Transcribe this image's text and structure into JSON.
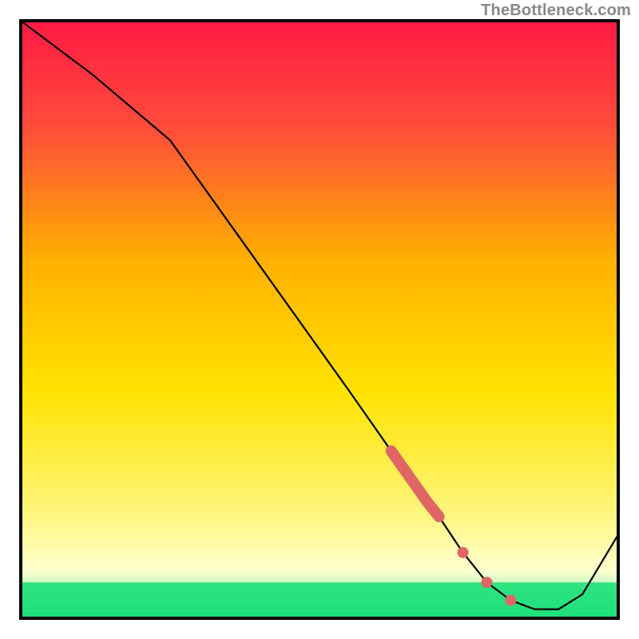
{
  "watermark": "TheBottleneck.com",
  "chart_data": {
    "type": "line",
    "title": "",
    "xlabel": "",
    "ylabel": "",
    "xlim": [
      0,
      100
    ],
    "ylim": [
      0,
      100
    ],
    "series": [
      {
        "name": "curve",
        "x": [
          0,
          12,
          25,
          35,
          45,
          55,
          62,
          68,
          70,
          74,
          78,
          82,
          86,
          90,
          94,
          100
        ],
        "y": [
          100,
          91,
          80,
          66,
          52,
          38,
          28,
          19.5,
          17,
          11,
          6,
          3,
          1.5,
          1.5,
          4,
          14
        ]
      }
    ],
    "highlight_segment": {
      "comment": "thick salmon overlay on the descending portion",
      "x": [
        62,
        68,
        70
      ],
      "y": [
        28,
        19.5,
        17
      ]
    },
    "highlight_dots": {
      "x": [
        74,
        78,
        82
      ],
      "y": [
        11,
        6,
        3
      ]
    },
    "background_gradient": {
      "top": "#ff1a44",
      "mid": "#ffd500",
      "bottom": "#1ee07a",
      "bottom_band_height_pct": 6
    },
    "colors": {
      "line": "#000000",
      "highlight": "#e06666",
      "frame": "#000000"
    }
  }
}
